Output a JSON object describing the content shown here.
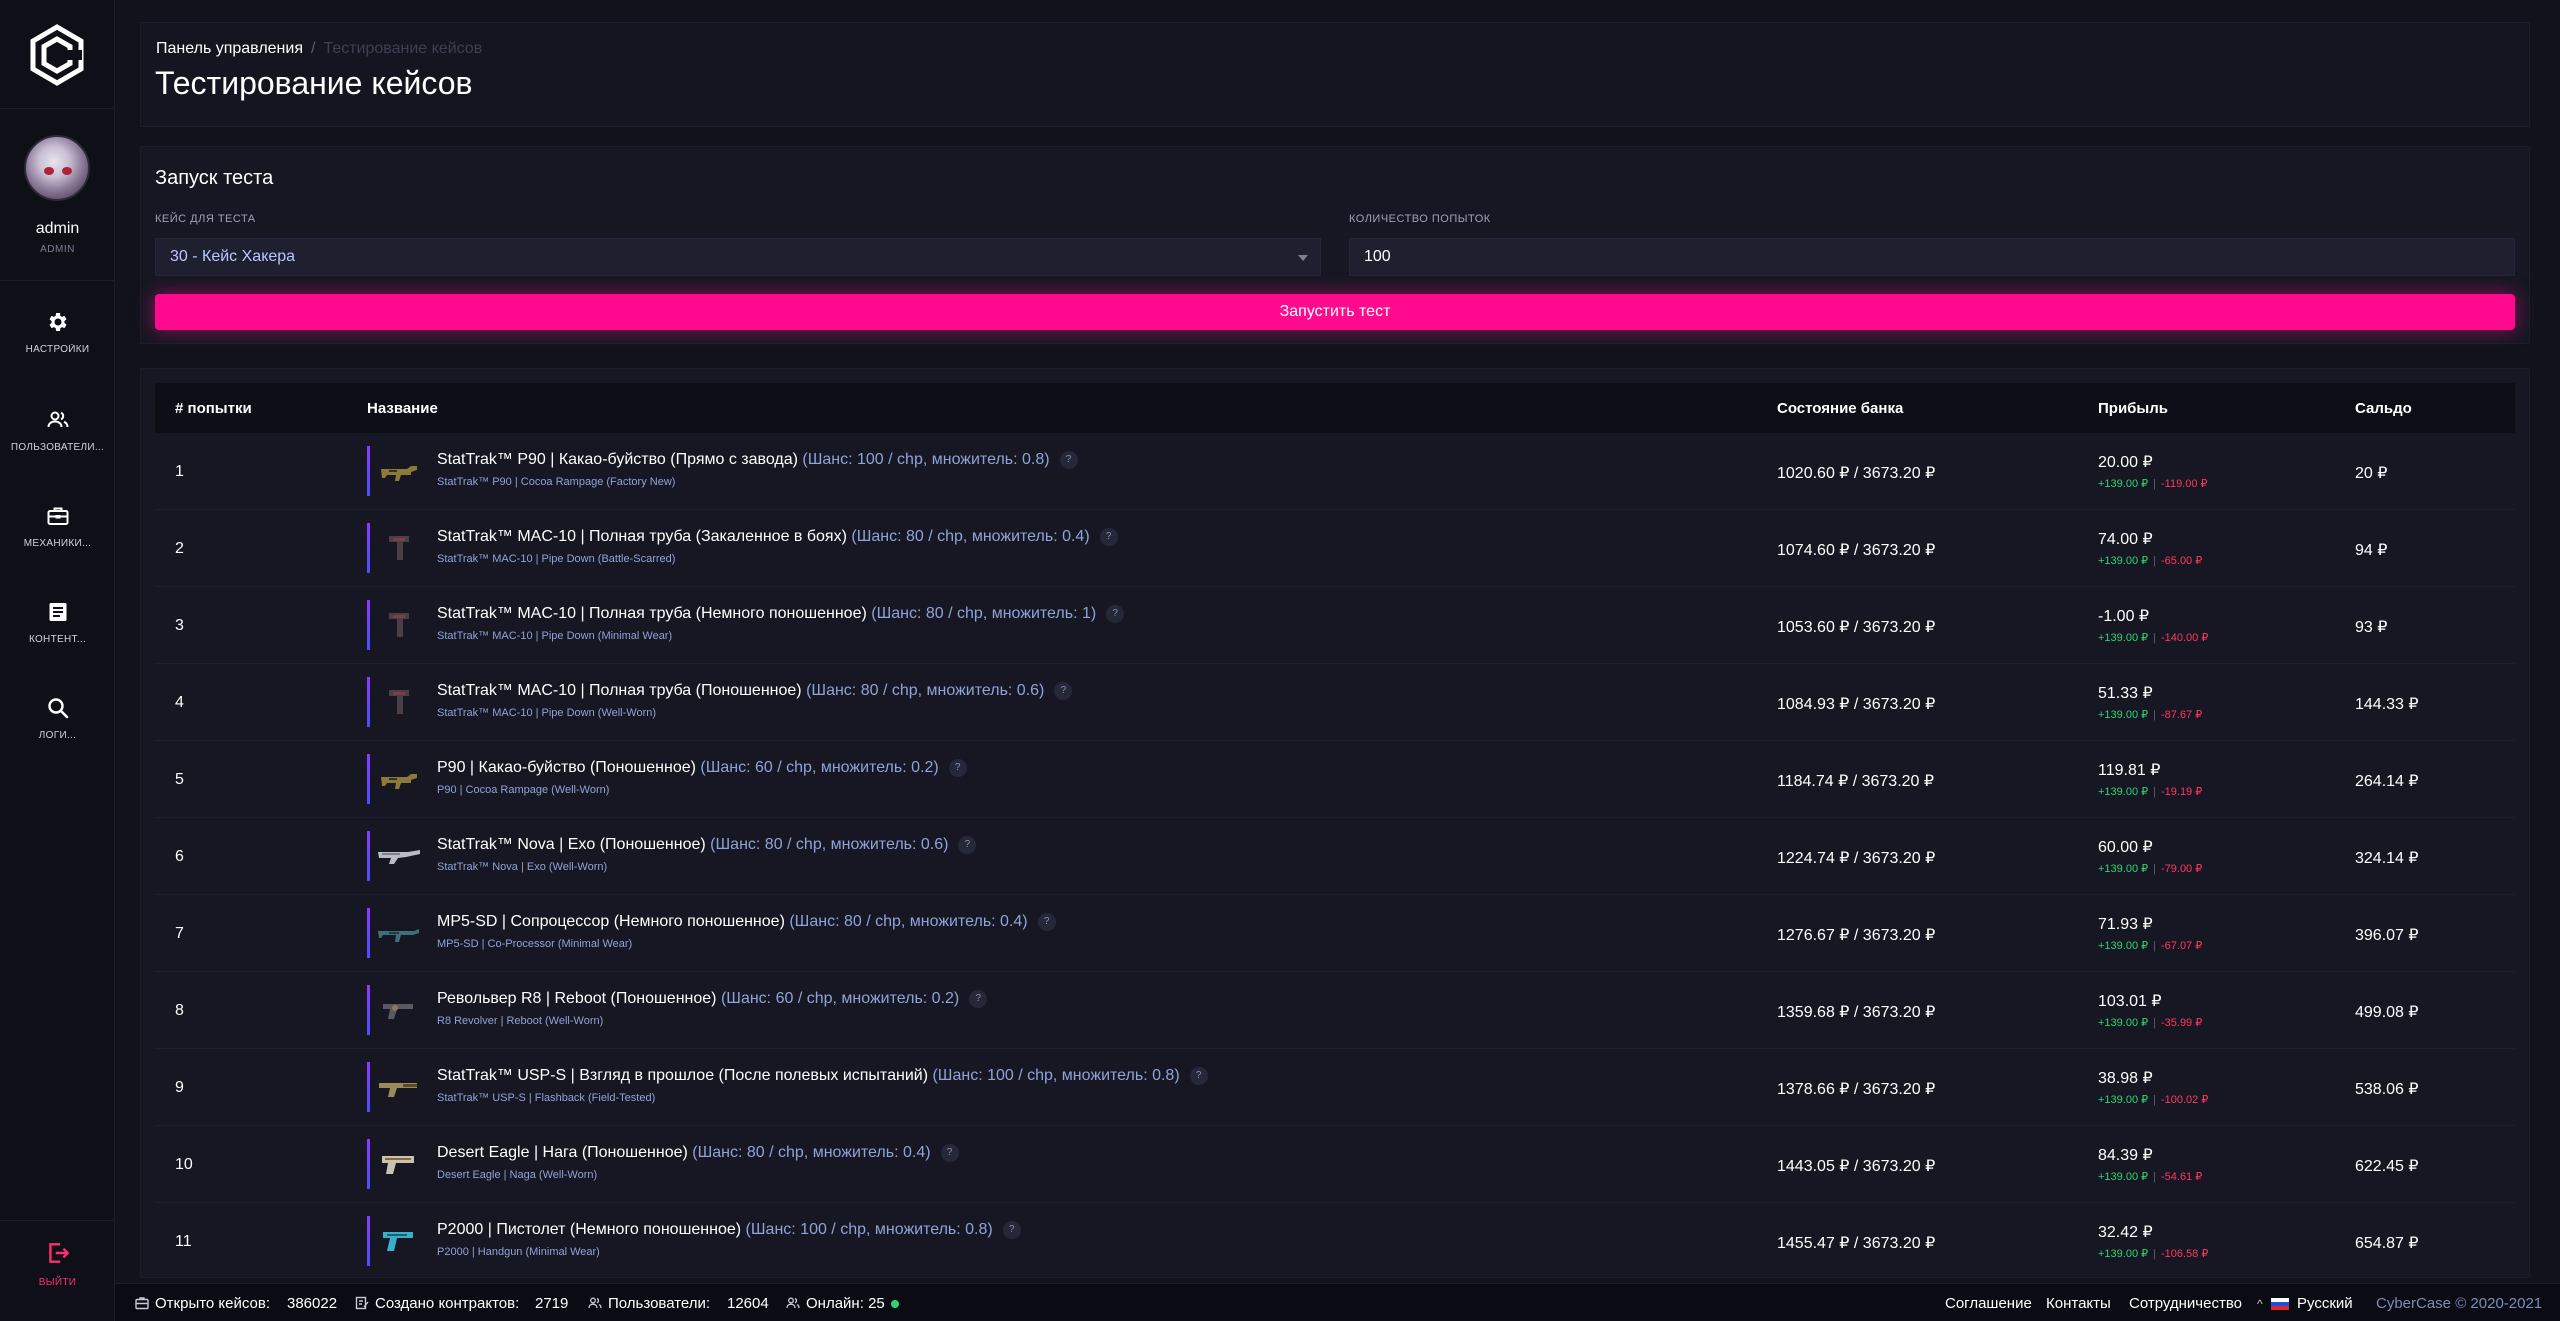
{
  "sidebar": {
    "user": {
      "name": "admin",
      "role": "ADMIN"
    },
    "items": [
      {
        "label": "НАСТРОЙКИ",
        "icon": "gear-icon"
      },
      {
        "label": "ПОЛЬЗОВАТЕЛИ...",
        "icon": "users-icon"
      },
      {
        "label": "МЕХАНИКИ...",
        "icon": "toolbox-icon"
      },
      {
        "label": "КОНТЕНТ...",
        "icon": "content-icon"
      },
      {
        "label": "ЛОГИ...",
        "icon": "search-icon"
      }
    ],
    "logout": {
      "label": "ВЫЙТИ",
      "icon": "logout-icon"
    }
  },
  "header": {
    "breadcrumb": {
      "root": "Панель управления",
      "separator": "/",
      "current": "Тестирование кейсов"
    },
    "title": "Тестирование кейсов"
  },
  "test_form": {
    "title": "Запуск теста",
    "case_label": "КЕЙС ДЛЯ ТЕСТА",
    "case_value": "30 - Кейс Хакера",
    "attempts_label": "КОЛИЧЕСТВО ПОПЫТОК",
    "attempts_value": "100",
    "run_button": "Запустить тест"
  },
  "table": {
    "columns": [
      "# попытки",
      "Название",
      "Состояние банка",
      "Прибыль",
      "Сальдо"
    ],
    "rows": [
      {
        "n": "1",
        "name": "StatTrak™ P90 | Какао-буйство (Прямо с завода)",
        "meta": "(Шанс: 100 / chp, множитель: 0.8)",
        "sub": "StatTrak™ P90 | Cocoa Rampage (Factory New)",
        "bank": "1020.60 ₽ / 3673.20 ₽",
        "profit": "20.00 ₽",
        "plus": "+139.00 ₽",
        "minus": "-119.00 ₽",
        "saldo": "20 ₽",
        "weapon": "smg"
      },
      {
        "n": "2",
        "name": "StatTrak™ MAC-10 | Полная труба (Закаленное в боях)",
        "meta": "(Шанс: 80 / chp, множитель: 0.4)",
        "sub": "StatTrak™ MAC-10 | Pipe Down (Battle-Scarred)",
        "bank": "1074.60 ₽ / 3673.20 ₽",
        "profit": "74.00 ₽",
        "plus": "+139.00 ₽",
        "minus": "-65.00 ₽",
        "saldo": "94 ₽",
        "weapon": "mac"
      },
      {
        "n": "3",
        "name": "StatTrak™ MAC-10 | Полная труба (Немного поношенное)",
        "meta": "(Шанс: 80 / chp, множитель: 1)",
        "sub": "StatTrak™ MAC-10 | Pipe Down (Minimal Wear)",
        "bank": "1053.60 ₽ / 3673.20 ₽",
        "profit": "-1.00 ₽",
        "plus": "+139.00 ₽",
        "minus": "-140.00 ₽",
        "saldo": "93 ₽",
        "weapon": "mac"
      },
      {
        "n": "4",
        "name": "StatTrak™ MAC-10 | Полная труба (Поношенное)",
        "meta": "(Шанс: 80 / chp, множитель: 0.6)",
        "sub": "StatTrak™ MAC-10 | Pipe Down (Well-Worn)",
        "bank": "1084.93 ₽ / 3673.20 ₽",
        "profit": "51.33 ₽",
        "plus": "+139.00 ₽",
        "minus": "-87.67 ₽",
        "saldo": "144.33 ₽",
        "weapon": "mac"
      },
      {
        "n": "5",
        "name": "P90 | Какао-буйство (Поношенное)",
        "meta": "(Шанс: 60 / chp, множитель: 0.2)",
        "sub": "P90 | Cocoa Rampage (Well-Worn)",
        "bank": "1184.74 ₽ / 3673.20 ₽",
        "profit": "119.81 ₽",
        "plus": "+139.00 ₽",
        "minus": "-19.19 ₽",
        "saldo": "264.14 ₽",
        "weapon": "smg"
      },
      {
        "n": "6",
        "name": "StatTrak™ Nova | Exo (Поношенное)",
        "meta": "(Шанс: 80 / chp, множитель: 0.6)",
        "sub": "StatTrak™ Nova | Exo (Well-Worn)",
        "bank": "1224.74 ₽ / 3673.20 ₽",
        "profit": "60.00 ₽",
        "plus": "+139.00 ₽",
        "minus": "-79.00 ₽",
        "saldo": "324.14 ₽",
        "weapon": "shotgun"
      },
      {
        "n": "7",
        "name": "MP5-SD | Сопроцессор (Немного поношенное)",
        "meta": "(Шанс: 80 / chp, множитель: 0.4)",
        "sub": "MP5-SD | Co-Processor (Minimal Wear)",
        "bank": "1276.67 ₽ / 3673.20 ₽",
        "profit": "71.93 ₽",
        "plus": "+139.00 ₽",
        "minus": "-67.07 ₽",
        "saldo": "396.07 ₽",
        "weapon": "mp5"
      },
      {
        "n": "8",
        "name": "Револьвер R8 | Reboot (Поношенное)",
        "meta": "(Шанс: 60 / chp, множитель: 0.2)",
        "sub": "R8 Revolver | Reboot (Well-Worn)",
        "bank": "1359.68 ₽ / 3673.20 ₽",
        "profit": "103.01 ₽",
        "plus": "+139.00 ₽",
        "minus": "-35.99 ₽",
        "saldo": "499.08 ₽",
        "weapon": "pistol"
      },
      {
        "n": "9",
        "name": "StatTrak™ USP-S | Взгляд в прошлое (После полевых испытаний)",
        "meta": "(Шанс: 100 / chp, множитель: 0.8)",
        "sub": "StatTrak™ USP-S | Flashback (Field-Tested)",
        "bank": "1378.66 ₽ / 3673.20 ₽",
        "profit": "38.98 ₽",
        "plus": "+139.00 ₽",
        "minus": "-100.02 ₽",
        "saldo": "538.06 ₽",
        "weapon": "usp"
      },
      {
        "n": "10",
        "name": "Desert Eagle | Нага (Поношенное)",
        "meta": "(Шанс: 80 / chp, множитель: 0.4)",
        "sub": "Desert Eagle | Naga (Well-Worn)",
        "bank": "1443.05 ₽ / 3673.20 ₽",
        "profit": "84.39 ₽",
        "plus": "+139.00 ₽",
        "minus": "-54.61 ₽",
        "saldo": "622.45 ₽",
        "weapon": "deagle"
      },
      {
        "n": "11",
        "name": "P2000 | Пистолет (Немного поношенное)",
        "meta": "(Шанс: 100 / chp, множитель: 0.8)",
        "sub": "P2000 | Handgun (Minimal Wear)",
        "bank": "1455.47 ₽ / 3673.20 ₽",
        "profit": "32.42 ₽",
        "plus": "+139.00 ₽",
        "minus": "-106.58 ₽",
        "saldo": "654.87 ₽",
        "weapon": "p2000"
      }
    ]
  },
  "footer": {
    "cases_opened_label": "Открыто кейсов:",
    "cases_opened": "386022",
    "contracts_label": "Создано контрактов:",
    "contracts": "2719",
    "users_label": "Пользователи:",
    "users": "12604",
    "online_label": "Онлайн:",
    "online": "25",
    "links": [
      "Соглашение",
      "Контакты",
      "Сотрудничество"
    ],
    "language": "Русский",
    "copyright": "CyberCase © 2020-2021"
  },
  "colors": {
    "accent": "#ff0a8e",
    "plus": "#2ed573",
    "minus": "#ff3860",
    "meta": "#8ea3d8",
    "background": "#11121c"
  }
}
